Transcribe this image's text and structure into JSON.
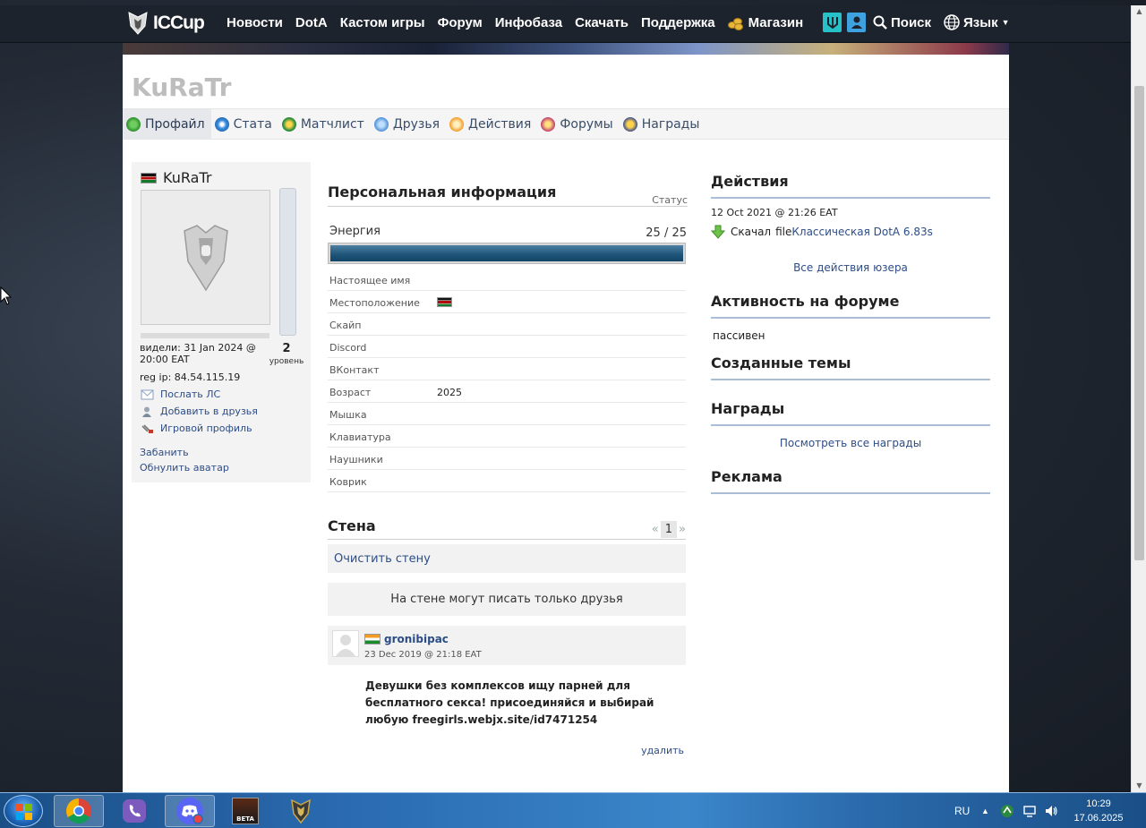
{
  "nav": {
    "logo": "ICCup",
    "links": [
      "Новости",
      "DotA",
      "Кастом игры",
      "Форум",
      "Инфобаза",
      "Скачать",
      "Поддержка"
    ],
    "shop": "Магазин",
    "search": "Поиск",
    "language": "Язык"
  },
  "profile": {
    "username": "KuRaTr",
    "tabs": [
      "Профайл",
      "Стата",
      "Матчлист",
      "Друзья",
      "Действия",
      "Форумы",
      "Награды"
    ],
    "level": "2",
    "level_label": "уровень",
    "seen": "видели: 31 Jan 2024 @ 20:00 EAT",
    "reg_ip": "reg ip: 84.54.115.19",
    "actions": [
      "Послать ЛС",
      "Добавить в друзья",
      "Игровой профиль"
    ],
    "ban": "Забанить",
    "reset_avatar": "Обнулить аватар"
  },
  "personal": {
    "title": "Персональная информация",
    "status_label": "Статус",
    "energy_label": "Энергия",
    "energy_value": "25 / 25",
    "energy_fraction": 1.0,
    "rows": [
      {
        "k": "Настоящее имя",
        "v": ""
      },
      {
        "k": "Местоположение",
        "v": ""
      },
      {
        "k": "Скайп",
        "v": ""
      },
      {
        "k": "Discord",
        "v": ""
      },
      {
        "k": "ВКонтакт",
        "v": ""
      },
      {
        "k": "Возраст",
        "v": "2025"
      },
      {
        "k": "Мышка",
        "v": ""
      },
      {
        "k": "Клавиатура",
        "v": ""
      },
      {
        "k": "Наушники",
        "v": ""
      },
      {
        "k": "Коврик",
        "v": ""
      }
    ]
  },
  "wall": {
    "title": "Стена",
    "pager_prev": "«",
    "pager_page": "1",
    "pager_next": "»",
    "clear": "Очистить стену",
    "notice": "На стене могут писать только друзья",
    "post": {
      "author": "gronibipac",
      "date": "23 Dec 2019 @ 21:18 EAT",
      "text": "Девушки без комплексов ищу парней для бесплатного секса! присоединяйся и выбирай любую freegirls.webjx.site/id7471254",
      "delete": "удалить"
    }
  },
  "right": {
    "actions_title": "Действия",
    "action_date": "12 Oct 2021 @ 21:26 EAT",
    "action_text": "Скачал",
    "action_file_prefix": "file",
    "action_file": "Классическая DotA 6.83s",
    "all_actions": "Все действия юзера",
    "forum_title": "Активность на форуме",
    "forum_value": "пассивен",
    "topics_title": "Созданные темы",
    "awards_title": "Награды",
    "all_awards": "Посмотреть все награды",
    "ads_title": "Реклама"
  },
  "taskbar": {
    "lang": "RU",
    "time": "10:29",
    "date": "17.06.2025",
    "beta": "BETA"
  }
}
